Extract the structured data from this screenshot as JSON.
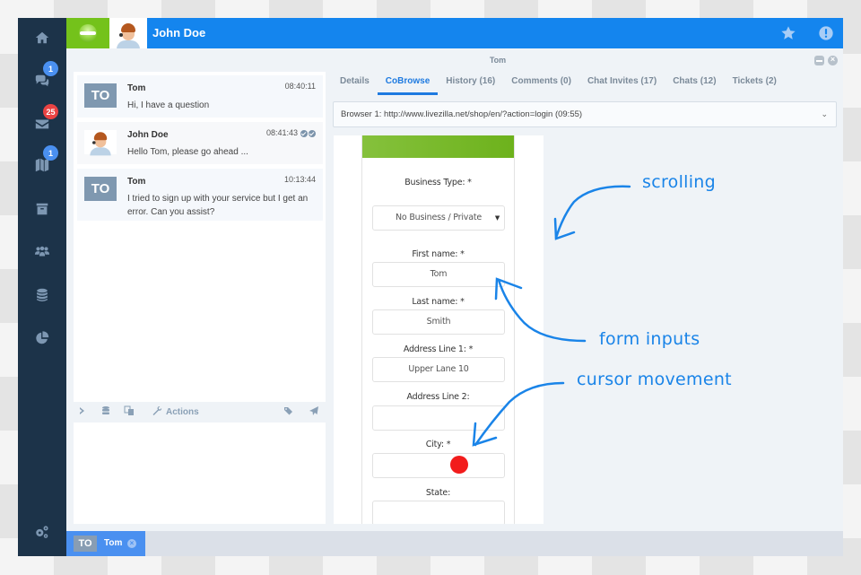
{
  "header": {
    "operator_name": "John Doe",
    "icons": [
      "star-icon",
      "alert-icon"
    ]
  },
  "sidebar": {
    "items": [
      {
        "name": "home",
        "icon": "home-icon"
      },
      {
        "name": "chats",
        "icon": "chat-bubbles-icon",
        "badge": "1",
        "badge_color": "#4a90f0"
      },
      {
        "name": "tickets",
        "icon": "envelope-icon",
        "badge": "25",
        "badge_color": "#e94343"
      },
      {
        "name": "visitors",
        "icon": "map-icon",
        "badge": "1",
        "badge_color": "#4a90f0"
      },
      {
        "name": "archive",
        "icon": "archive-box-icon"
      },
      {
        "name": "users",
        "icon": "users-icon"
      },
      {
        "name": "database",
        "icon": "database-icon"
      },
      {
        "name": "reports",
        "icon": "pie-chart-icon"
      },
      {
        "name": "settings",
        "icon": "gears-icon"
      }
    ]
  },
  "chat": {
    "messages": [
      {
        "avatar_initials": "TO",
        "sender": "Tom",
        "time": "08:40:11",
        "text": "Hi, I have a question"
      },
      {
        "avatar_photo": true,
        "sender": "John Doe",
        "time": "08:41:43",
        "read": true,
        "text": "Hello Tom, please go ahead ..."
      },
      {
        "avatar_initials": "TO",
        "sender": "Tom",
        "time": "10:13:44",
        "text": "I tried to sign up with your service but I get an error. Can you assist?"
      }
    ],
    "toolbar": {
      "actions_label": "Actions"
    },
    "input_value": ""
  },
  "panel": {
    "title": "Tom",
    "tabs": [
      {
        "label": "Details"
      },
      {
        "label": "CoBrowse",
        "active": true
      },
      {
        "label": "History (16)"
      },
      {
        "label": "Comments (0)"
      },
      {
        "label": "Chat Invites (17)"
      },
      {
        "label": "Chats (12)"
      },
      {
        "label": "Tickets (2)"
      }
    ],
    "browser_select": "Browser 1: http://www.livezilla.net/shop/en/?action=login (09:55)"
  },
  "cobrowse_form": {
    "fields": [
      {
        "label": "Business Type: *",
        "value": "No Business / Private",
        "type": "select"
      },
      {
        "label": "First name: *",
        "value": "Tom"
      },
      {
        "label": "Last name: *",
        "value": "Smith"
      },
      {
        "label": "Address Line 1: *",
        "value": "Upper Lane 10"
      },
      {
        "label": "Address Line 2:",
        "value": ""
      },
      {
        "label": "City: *",
        "value": ""
      },
      {
        "label": "State:",
        "value": ""
      }
    ],
    "cursor_color": "#f21c1c"
  },
  "annotations": {
    "scrolling": "scrolling",
    "form_inputs": "form inputs",
    "cursor_movement": "cursor movement",
    "color": "#1a84e8"
  },
  "bottom_bar": {
    "open_chat": {
      "initials": "TO",
      "name": "Tom"
    }
  }
}
